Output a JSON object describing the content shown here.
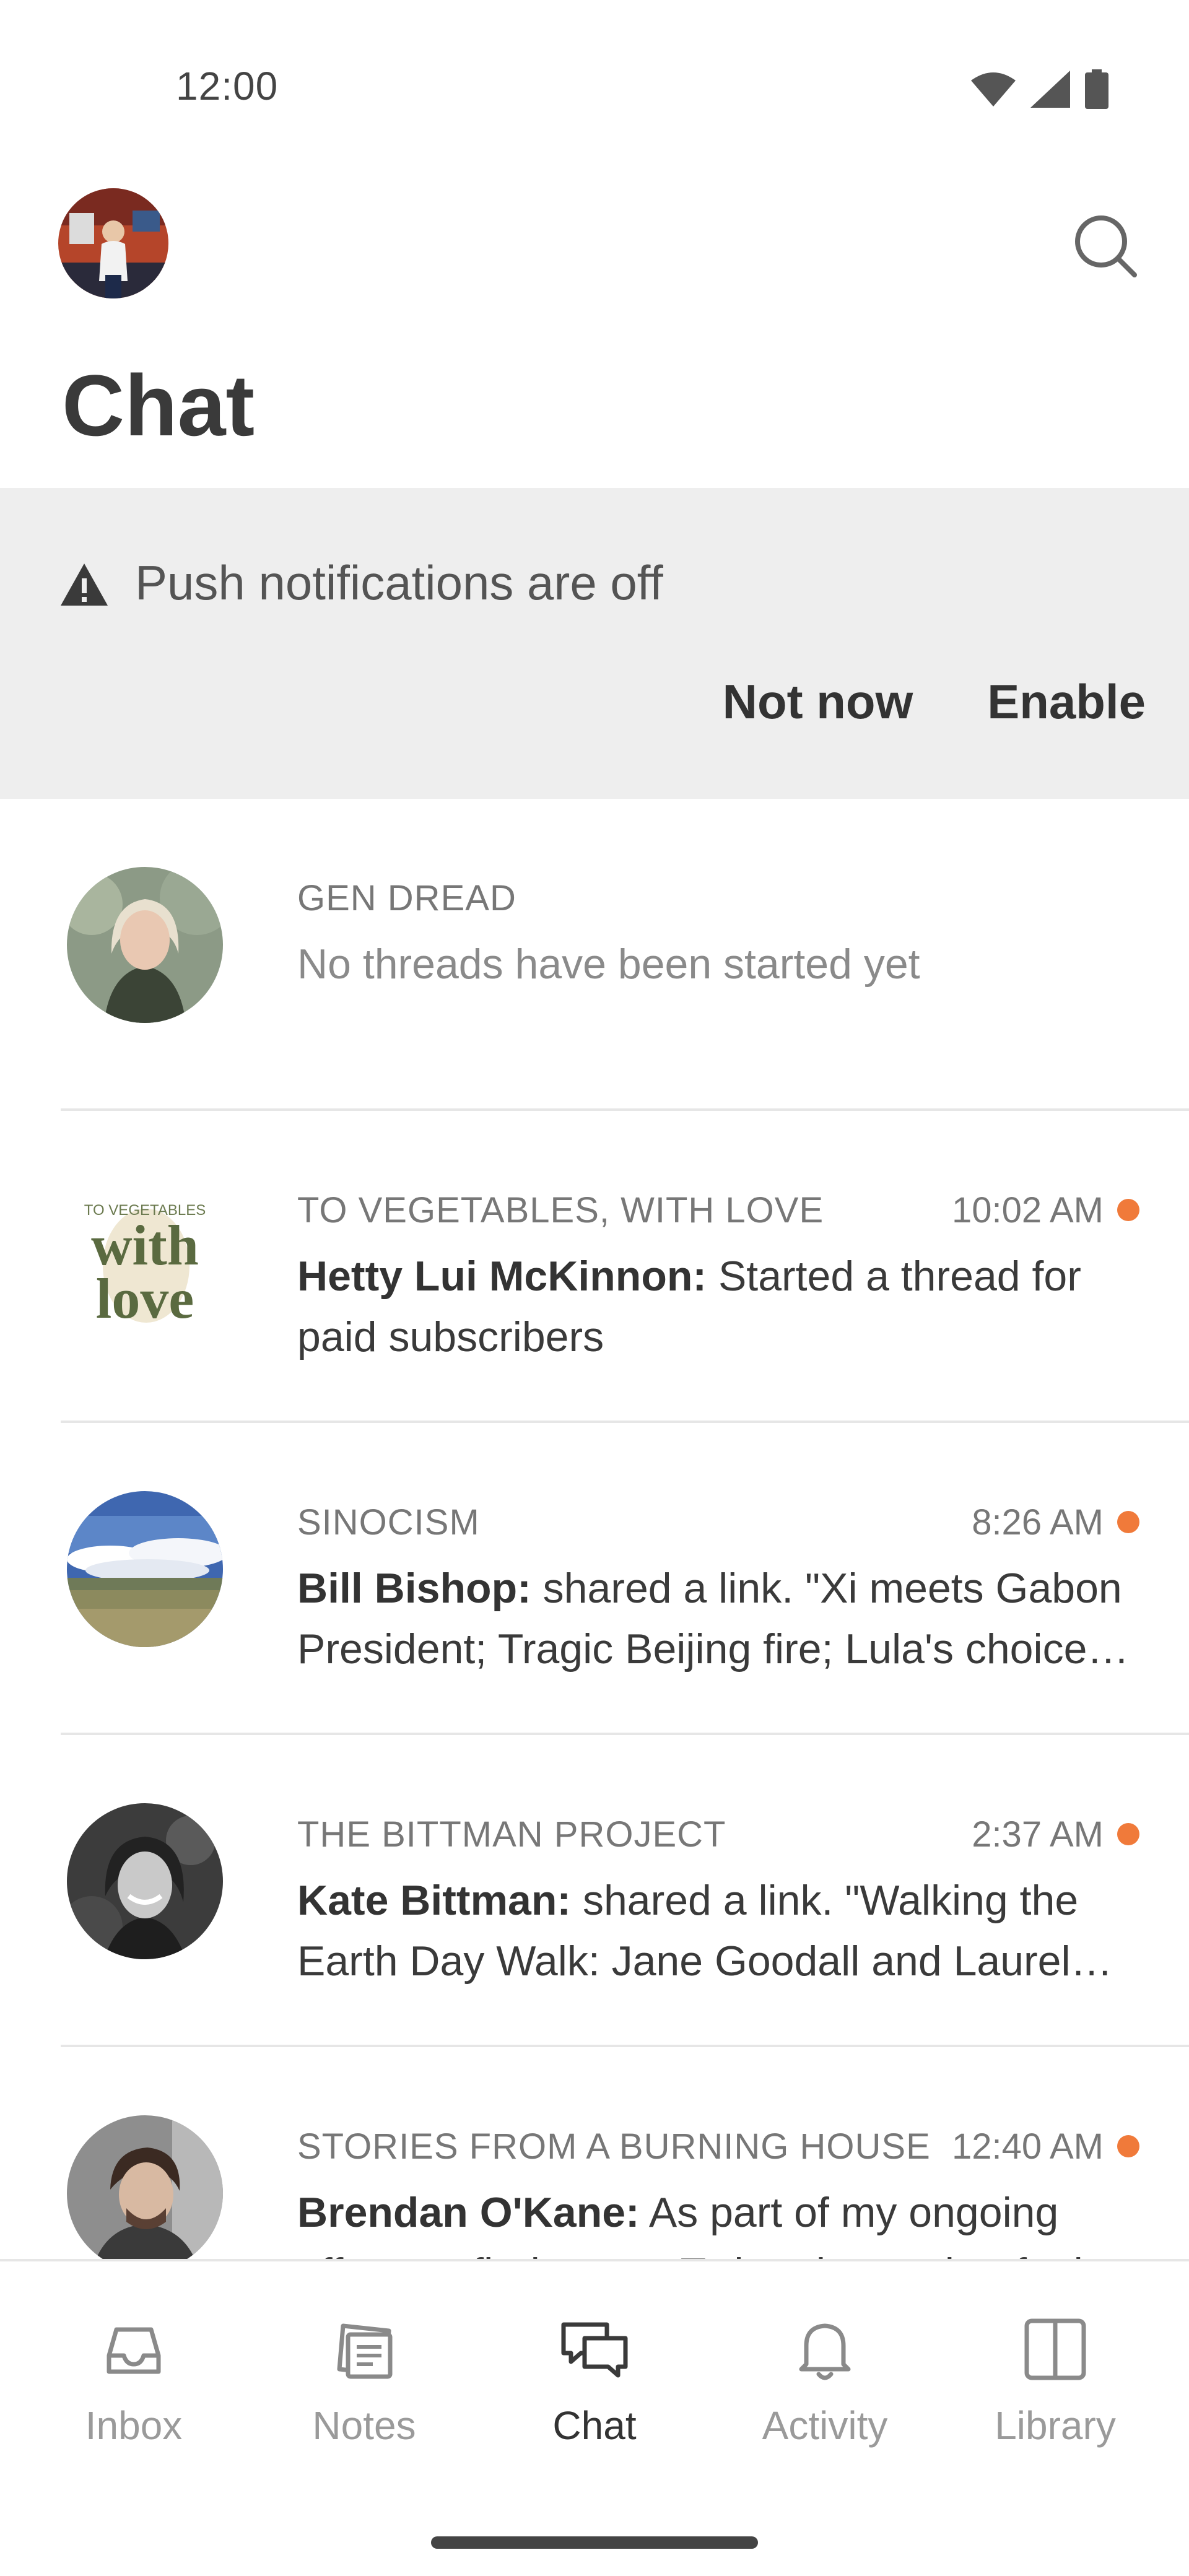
{
  "status_bar": {
    "time": "12:00",
    "icons": [
      "wifi-icon",
      "cellular-icon",
      "battery-icon"
    ]
  },
  "header": {
    "title": "Chat",
    "avatar_icon": "profile-avatar",
    "search_icon": "search-icon"
  },
  "banner": {
    "icon": "warning-icon",
    "message": "Push notifications are off",
    "not_now_label": "Not now",
    "enable_label": "Enable"
  },
  "chats": [
    {
      "publication": "GEN DREAD",
      "time": "",
      "author": "",
      "preview": "No threads have been started yet",
      "unread": false,
      "muted": true
    },
    {
      "publication": "TO VEGETABLES, WITH LOVE",
      "logo_small": "TO VEGETABLES",
      "logo_large_1": "with",
      "logo_large_2": "love",
      "time": "10:02 AM",
      "author": "Hetty Lui McKinnon:",
      "preview": " Started a thread for paid subscribers",
      "unread": true,
      "muted": false
    },
    {
      "publication": "SINOCISM",
      "time": "8:26 AM",
      "author": "Bill Bishop:",
      "preview": " shared a link. \"Xi meets Gabon President; Tragic Beijing fire; Lula's choice of partners\"",
      "unread": true,
      "muted": false
    },
    {
      "publication": "THE BITTMAN PROJECT",
      "time": "2:37 AM",
      "author": "Kate Bittman:",
      "preview": " shared a link. \"Walking the Earth Day Walk: Jane Goodall and Laurel Neme\"",
      "unread": true,
      "muted": false
    },
    {
      "publication": "STORIES FROM A BURNING HOUSE",
      "time": "12:40 AM",
      "author": "Brendan O'Kane:",
      "preview": " As part of my ongoing efforts to find a post-Twitter home that feels right",
      "unread": true,
      "muted": false
    }
  ],
  "nav": {
    "items": [
      {
        "label": "Inbox",
        "icon": "inbox-icon",
        "active": false
      },
      {
        "label": "Notes",
        "icon": "notes-icon",
        "active": false
      },
      {
        "label": "Chat",
        "icon": "chat-icon",
        "active": true
      },
      {
        "label": "Activity",
        "icon": "bell-icon",
        "active": false
      },
      {
        "label": "Library",
        "icon": "library-icon",
        "active": false
      }
    ]
  },
  "colors": {
    "accent_unread": "#f07a3a",
    "banner_bg": "#eeeeee",
    "text_primary": "#333333",
    "text_muted": "#8a8a8a"
  }
}
